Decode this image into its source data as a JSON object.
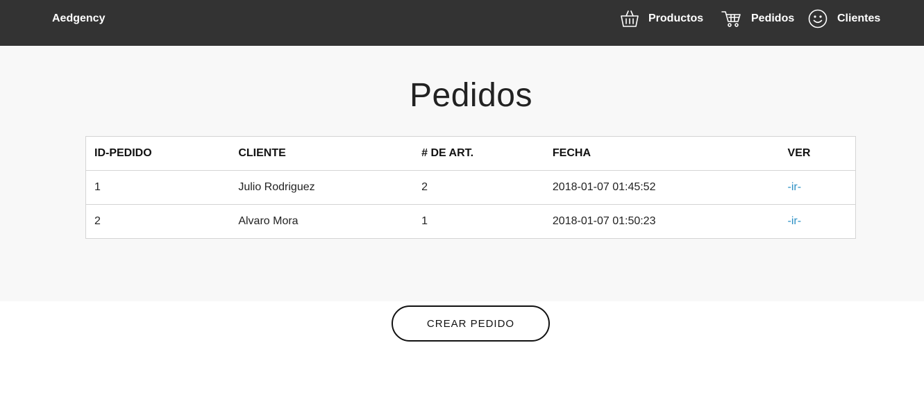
{
  "navbar": {
    "brand": "Aedgency",
    "items": [
      {
        "label": "Productos",
        "icon": "basket-icon"
      },
      {
        "label": "Pedidos",
        "icon": "cart-icon"
      },
      {
        "label": "Clientes",
        "icon": "smiley-icon"
      }
    ]
  },
  "main": {
    "title": "Pedidos",
    "table": {
      "headers": [
        "ID-PEDIDO",
        "CLIENTE",
        "# DE ART.",
        "FECHA",
        "VER"
      ],
      "rows": [
        {
          "id": "1",
          "cliente": "Julio Rodriguez",
          "articulos": "2",
          "fecha": "2018-01-07 01:45:52",
          "ver": "-ir-"
        },
        {
          "id": "2",
          "cliente": "Alvaro Mora",
          "articulos": "1",
          "fecha": "2018-01-07 01:50:23",
          "ver": "-ir-"
        }
      ]
    },
    "create_button": "CREAR PEDIDO"
  },
  "colors": {
    "navbar_bg": "#333333",
    "content_bg": "#f8f8f8",
    "link": "#2a8fc4"
  }
}
